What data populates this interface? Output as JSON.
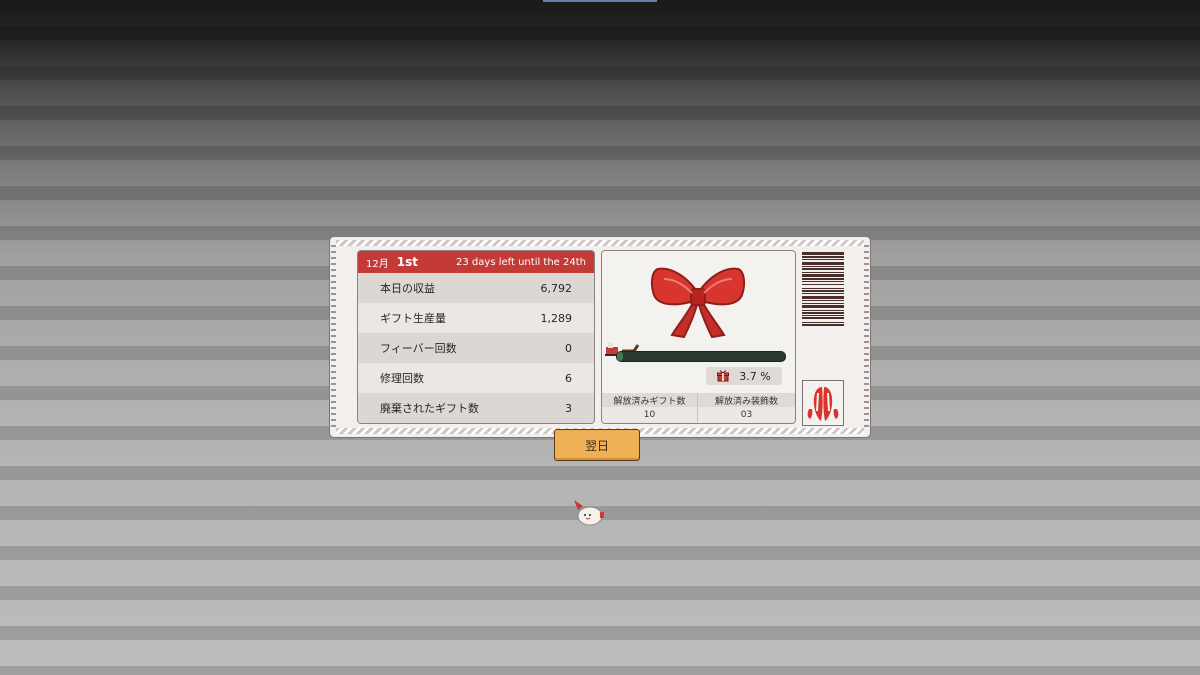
{
  "summary": {
    "month": "12月",
    "day": "1st",
    "countdown": "23 days left until the 24th",
    "stats": [
      {
        "label": "本日の収益",
        "value": "6,792"
      },
      {
        "label": "ギフト生産量",
        "value": "1,289"
      },
      {
        "label": "フィーバー回数",
        "value": "0"
      },
      {
        "label": "修理回数",
        "value": "6"
      },
      {
        "label": "廃棄されたギフト数",
        "value": "3"
      }
    ]
  },
  "gift": {
    "progress_percent": 3.7,
    "percent_label": "3.7 %",
    "unlocked_gifts_label": "解放済みギフト数",
    "unlocked_gifts_value": "10",
    "unlocked_decor_label": "解放済み装飾数",
    "unlocked_decor_value": "03",
    "bow_icon": "red-ribbon-bow-icon",
    "sleigh_icon": "santa-sleigh-icon",
    "gift_icon": "gift-box-icon"
  },
  "buttons": {
    "next_day": "翌日"
  },
  "colors": {
    "header_red": "#c43a37",
    "button_orange": "#f0b055",
    "progress_green": "#3f7a52"
  }
}
